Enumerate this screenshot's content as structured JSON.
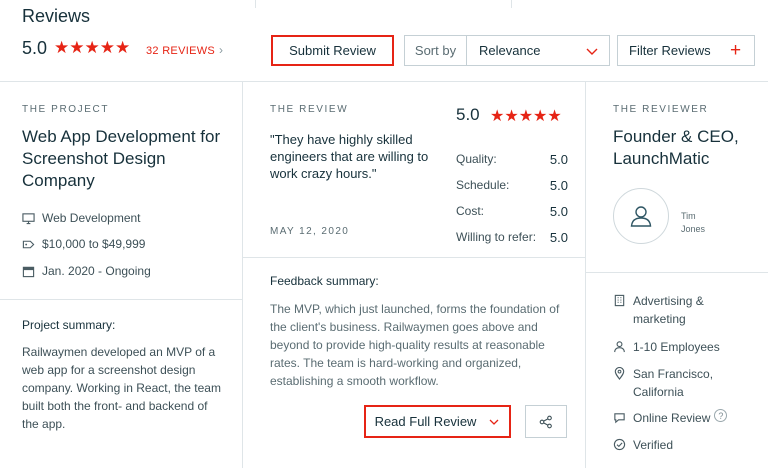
{
  "header": {
    "title": "Reviews",
    "rating": "5.0",
    "stars": "★★★★★",
    "review_count": "32 REVIEWS",
    "count_chevron": "›",
    "submit_label": "Submit Review",
    "sort_label": "Sort by",
    "sort_value": "Relevance",
    "filter_label": "Filter Reviews",
    "filter_plus": "+"
  },
  "project": {
    "caption": "THE PROJECT",
    "title": "Web App Development for Screenshot Design Company",
    "service": "Web Development",
    "budget": "$10,000 to $49,999",
    "dates": "Jan. 2020 - Ongoing",
    "summary_heading": "Project summary:",
    "summary_text": "Railwaymen developed an MVP of a web app for a screenshot design company. Working in React, the team built both the front- and backend of the app."
  },
  "review": {
    "caption": "THE REVIEW",
    "quote": "\"They have highly skilled engineers that are willing to work crazy hours.\"",
    "date": "MAY 12, 2020",
    "overall": "5.0",
    "stars": "★★★★★",
    "scores": [
      {
        "label": "Quality:",
        "value": "5.0"
      },
      {
        "label": "Schedule:",
        "value": "5.0"
      },
      {
        "label": "Cost:",
        "value": "5.0"
      },
      {
        "label": "Willing to refer:",
        "value": "5.0"
      }
    ],
    "feedback_heading": "Feedback summary:",
    "feedback_text": "The MVP, which just launched, forms the foundation of the client's business. Railwaymen goes above and beyond to provide high-quality results at reasonable rates. The team is hard-working and organized, establishing a smooth workflow.",
    "read_full_label": "Read Full Review"
  },
  "reviewer": {
    "caption": "THE REVIEWER",
    "title": "Founder & CEO, LaunchMatic",
    "name": "Tim Jones",
    "industry": "Advertising & marketing",
    "size": "1-10 Employees",
    "location": "San Francisco, California",
    "review_type": "Online Review",
    "help": "?",
    "verified": "Verified"
  },
  "colors": {
    "accent": "#e62415",
    "text": "#17313b",
    "border": "#c5d0d5"
  }
}
